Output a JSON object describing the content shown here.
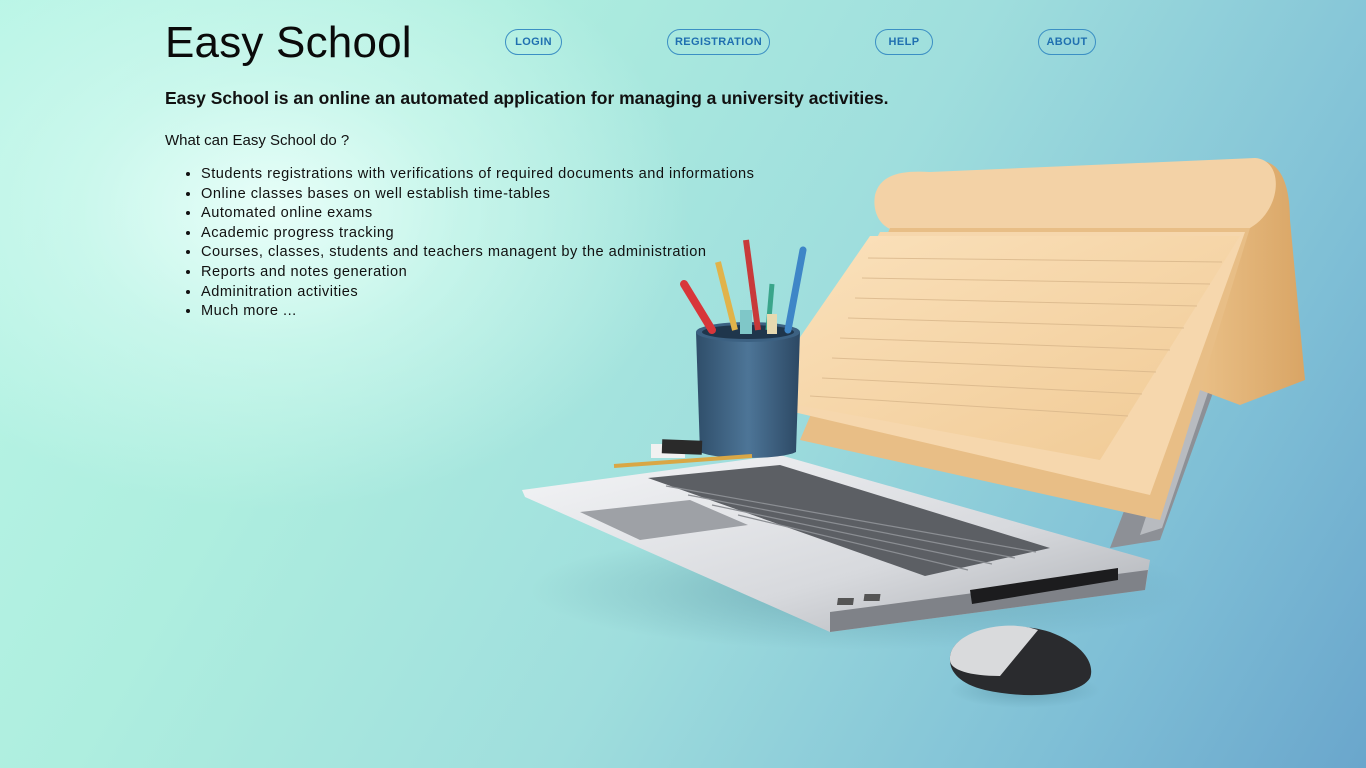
{
  "header": {
    "brand": "Easy School",
    "nav": [
      {
        "id": "login",
        "label": "LOGIN"
      },
      {
        "id": "registration",
        "label": "REGISTRATION"
      },
      {
        "id": "help",
        "label": "HELP"
      },
      {
        "id": "about",
        "label": "ABOUT"
      }
    ]
  },
  "main": {
    "tagline": "Easy School is an online an automated application for managing a university activities.",
    "question": "What can Easy School do ?",
    "features": [
      "Students registrations with verifications of required documents and informations",
      "Online classes bases on well establish time-tables",
      "Automated online exams",
      "Academic progress tracking",
      "Courses, classes, students and teachers managent by the administration",
      "Reports and notes generation",
      "Adminitration activities",
      "Much more ..."
    ]
  },
  "illustration": {
    "icon": "laptop-notebook-illustration"
  },
  "colors": {
    "nav_border": "#3b8fc4",
    "nav_text": "#1f6fb0",
    "bg_light": "#b9f5e6",
    "bg_dark": "#6aa6cc"
  }
}
